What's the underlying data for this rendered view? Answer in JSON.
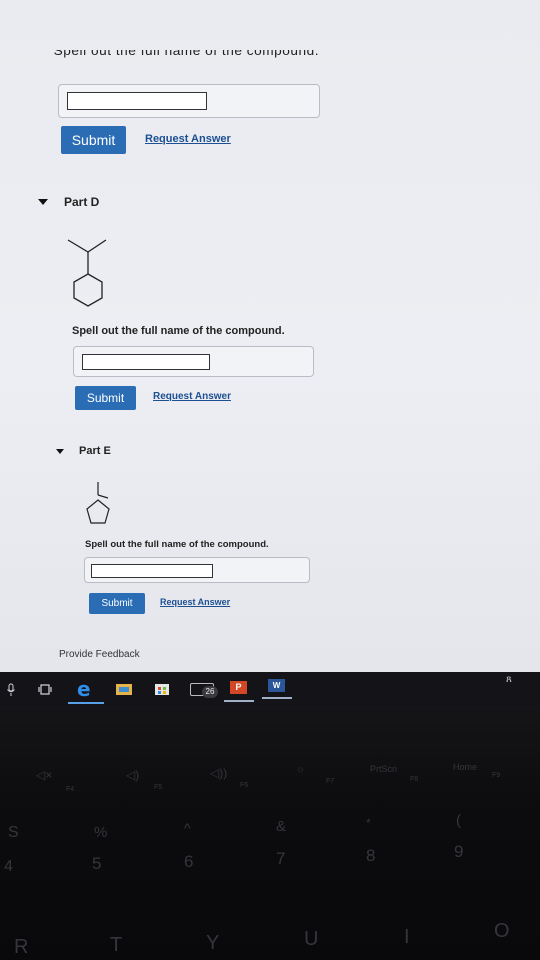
{
  "top_section": {
    "cut_prompt": "Spell out the full name of the compound.",
    "input_value": "",
    "submit_label": "Submit",
    "request_label": "Request Answer"
  },
  "parts": [
    {
      "title": "Part D",
      "prompt": "Spell out the full name of the compound.",
      "input_value": "",
      "submit_label": "Submit",
      "request_label": "Request Answer"
    },
    {
      "title": "Part E",
      "prompt": "Spell out the full name of the compound.",
      "input_value": "",
      "submit_label": "Submit",
      "request_label": "Request Answer"
    }
  ],
  "footer": {
    "feedback_label": "Provide Feedback"
  },
  "taskbar": {
    "badge_count": "26",
    "ppt_letter": "P",
    "word_letter": "W",
    "corner_glyph": "ጸ"
  },
  "keyboard": {
    "fn_row": [
      "F4",
      "F5",
      "F6",
      "F7",
      "PrtScn",
      "F8",
      "Home",
      "F9"
    ],
    "num_row": [
      "4",
      "%",
      "5",
      "^",
      "6",
      "&",
      "7",
      "*",
      "8",
      "(",
      "9"
    ],
    "letter_row": [
      "R",
      "T",
      "Y",
      "U",
      "I",
      "O"
    ],
    "side_letter": "S"
  },
  "colors": {
    "submit_blue": "#2a6db5",
    "link_blue": "#1d4f93",
    "page_bg": "#eceef3"
  }
}
